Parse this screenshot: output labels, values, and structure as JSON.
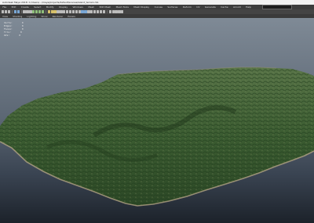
{
  "window": {
    "title": "Autodesk Maya 2018: C:/Users/.../maya/projects/default/scenes/island_terrain.mb"
  },
  "menubar": {
    "items": [
      "File",
      "Edit",
      "Create",
      "Select",
      "Modify",
      "Display",
      "Windows",
      "Mesh",
      "Edit Mesh",
      "Mesh Tools",
      "Mesh Display",
      "Curves",
      "Surfaces",
      "Deform",
      "UV",
      "Generate",
      "Cache",
      "Arnold",
      "Help"
    ],
    "mode": ""
  },
  "panel_menu": {
    "items": [
      "View",
      "Shading",
      "Lighting",
      "Show",
      "Renderer",
      "Panels"
    ]
  },
  "hud": {
    "rows": [
      {
        "label": "Verts:",
        "value": "0"
      },
      {
        "label": "Edges:",
        "value": "0"
      },
      {
        "label": "Faces:",
        "value": "0"
      },
      {
        "label": "Tris:",
        "value": "0"
      },
      {
        "label": "UVs:",
        "value": "0"
      }
    ]
  },
  "colors": {
    "sky_top": "#7f8a96",
    "sky_bottom": "#1c222a",
    "land_dark": "#1f3a1c",
    "land_mid": "#3b5c31",
    "land_light": "#587447",
    "coast": "#b9a888"
  }
}
